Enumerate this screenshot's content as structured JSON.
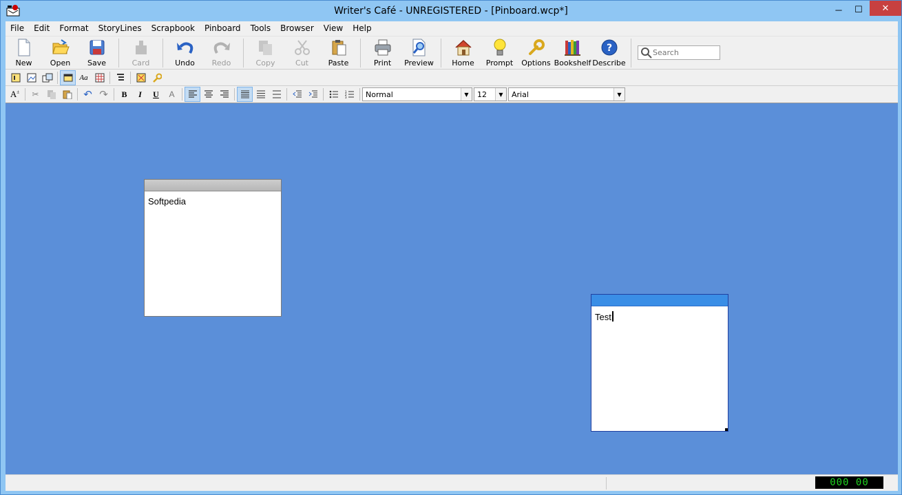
{
  "window": {
    "title": "Writer's Café - UNREGISTERED - [Pinboard.wcp*]"
  },
  "menu": [
    "File",
    "Edit",
    "Format",
    "StoryLines",
    "Scrapbook",
    "Pinboard",
    "Tools",
    "Browser",
    "View",
    "Help"
  ],
  "toolbar": {
    "new": "New",
    "open": "Open",
    "save": "Save",
    "card": "Card",
    "undo": "Undo",
    "redo": "Redo",
    "copy": "Copy",
    "cut": "Cut",
    "paste": "Paste",
    "print": "Print",
    "preview": "Preview",
    "home": "Home",
    "prompt": "Prompt",
    "options": "Options",
    "bookshelf": "Bookshelf",
    "describe": "Describe",
    "search_placeholder": "Search"
  },
  "format": {
    "style": "Normal",
    "size": "12",
    "font": "Arial",
    "bold": "B",
    "italic": "I",
    "underline": "U"
  },
  "cards": [
    {
      "text": "Softpedia"
    },
    {
      "text": "Test"
    }
  ],
  "status": {
    "timer": "000 00"
  },
  "colors": {
    "pinboard_bg": "#5b8fd9",
    "active_card_header": "#3a8ee6",
    "titlebar_bg": "#8fc6f3",
    "close_button": "#c74040",
    "timer_text": "#1fd41f"
  }
}
